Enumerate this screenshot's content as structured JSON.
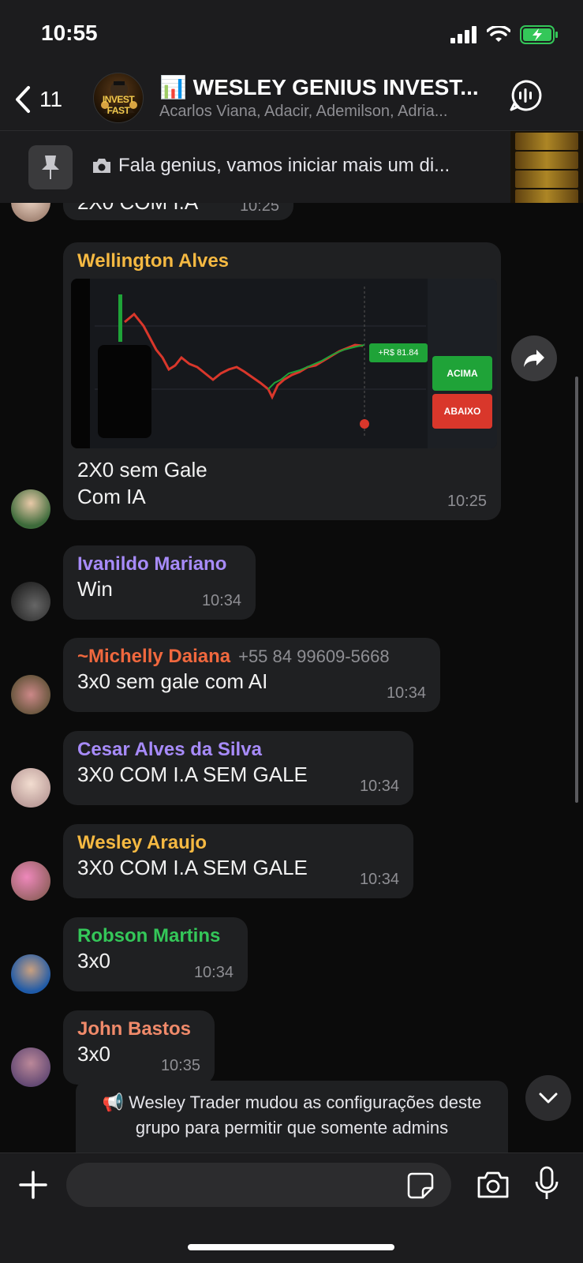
{
  "status_bar": {
    "time": "10:55",
    "icons": [
      "cellular-signal-icon",
      "wifi-icon",
      "battery-charging-icon"
    ]
  },
  "header": {
    "back_count": "11",
    "group_title": "📊 WESLEY GENIUS INVEST...",
    "members": "Acarlos Viana, Adacir, Ademilson, Adria...",
    "avatar_text": "INVEST FAST"
  },
  "pinned": {
    "text": "Fala genius, vamos iniciar mais um di..."
  },
  "partial_message": {
    "text": "2X0 COM I.A",
    "time": "10:25"
  },
  "messages": [
    {
      "sender": "Wellington Alves",
      "sender_color": "#f5b942",
      "lines": [
        "2X0 sem Gale",
        "Com IA"
      ],
      "time": "10:25",
      "has_image": true
    },
    {
      "sender": "Ivanildo Mariano",
      "sender_color": "#a78bfa",
      "lines": [
        "Win"
      ],
      "time": "10:34"
    },
    {
      "sender": "~Michelly Daiana",
      "sender_color": "#f0683e",
      "phone": "+55 84 99609-5668",
      "lines": [
        "3x0 sem gale com AI"
      ],
      "time": "10:34"
    },
    {
      "sender": "Cesar Alves da Silva",
      "sender_color": "#a78bfa",
      "lines": [
        "3X0 COM I.A SEM GALE"
      ],
      "time": "10:34"
    },
    {
      "sender": "Wesley Araujo",
      "sender_color": "#f5b942",
      "lines": [
        "3X0 COM I.A SEM GALE"
      ],
      "time": "10:34"
    },
    {
      "sender": "Robson Martins",
      "sender_color": "#34c759",
      "lines": [
        "3x0"
      ],
      "time": "10:34"
    },
    {
      "sender": "John Bastos",
      "sender_color": "#f08a6a",
      "lines": [
        "3x0"
      ],
      "time": "10:35"
    }
  ],
  "chart_image": {
    "acima_label": "ACIMA",
    "abaixo_label": "ABAIXO",
    "profit_label": "+R$ 81.84"
  },
  "system_message": {
    "text": "📢 Wesley Trader mudou as configurações deste grupo para permitir que somente admins"
  },
  "input": {
    "placeholder": ""
  }
}
